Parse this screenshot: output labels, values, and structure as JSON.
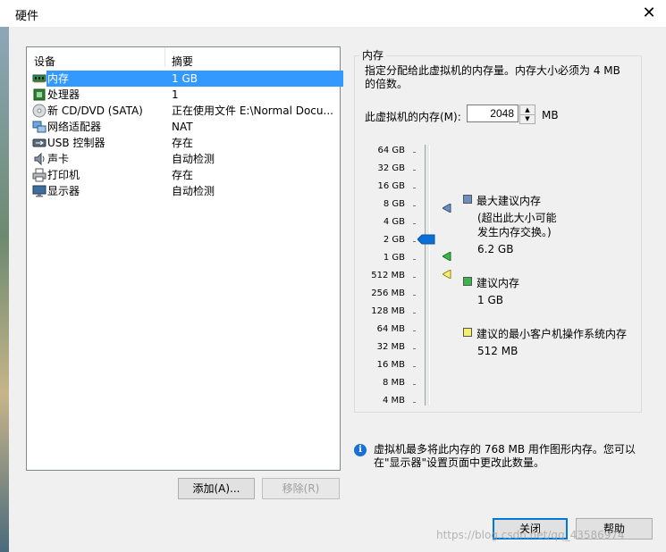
{
  "window": {
    "title": "硬件"
  },
  "device_list": {
    "headers": {
      "device": "设备",
      "summary": "摘要"
    },
    "rows": [
      {
        "icon": "memory-icon",
        "name": "内存",
        "summary": "1 GB",
        "selected": true
      },
      {
        "icon": "processor-icon",
        "name": "处理器",
        "summary": "1"
      },
      {
        "icon": "cd-dvd-icon",
        "name": "新 CD/DVD (SATA)",
        "summary": "正在使用文件 E:\\Normal Docu..."
      },
      {
        "icon": "network-adapter-icon",
        "name": "网络适配器",
        "summary": "NAT"
      },
      {
        "icon": "usb-controller-icon",
        "name": "USB 控制器",
        "summary": "存在"
      },
      {
        "icon": "sound-card-icon",
        "name": "声卡",
        "summary": "自动检测"
      },
      {
        "icon": "printer-icon",
        "name": "打印机",
        "summary": "存在"
      },
      {
        "icon": "display-icon",
        "name": "显示器",
        "summary": "自动检测"
      }
    ]
  },
  "buttons": {
    "add": "添加(A)...",
    "remove": "移除(R)",
    "close": "关闭",
    "help": "帮助"
  },
  "memory": {
    "group_title": "内存",
    "description": "指定分配给此虚拟机的内存量。内存大小必须为 4 MB 的倍数。",
    "field_label": "此虚拟机的内存(M):",
    "value": "2048",
    "unit": "MB",
    "scale": [
      "64 GB",
      "32 GB",
      "16 GB",
      "8 GB",
      "4 GB",
      "2 GB",
      "1 GB",
      "512 MB",
      "256 MB",
      "128 MB",
      "64 MB",
      "32 MB",
      "16 MB",
      "8 MB",
      "4 MB"
    ],
    "legend": {
      "max": {
        "title": "最大建议内存",
        "note_line1": "(超出此大小可能",
        "note_line2": "发生内存交换。)",
        "value": "6.2 GB",
        "color": "#6d8fbf"
      },
      "recommended": {
        "title": "建议内存",
        "value": "1 GB",
        "color": "#39b54a"
      },
      "min_guest": {
        "title": "建议的最小客户机操作系统内存",
        "value": "512 MB",
        "color": "#f5f06c"
      }
    }
  },
  "info": {
    "line1": "虚拟机最多将此内存的 768 MB 用作图形内存。您可以",
    "line2": "在\"显示器\"设置页面中更改此数量。"
  },
  "watermark": "https://blog.csdn.net/qq_43586974",
  "colors": {
    "selection": "#3399ff",
    "thumb": "#0a6fd6",
    "accent": "#0078d7"
  }
}
